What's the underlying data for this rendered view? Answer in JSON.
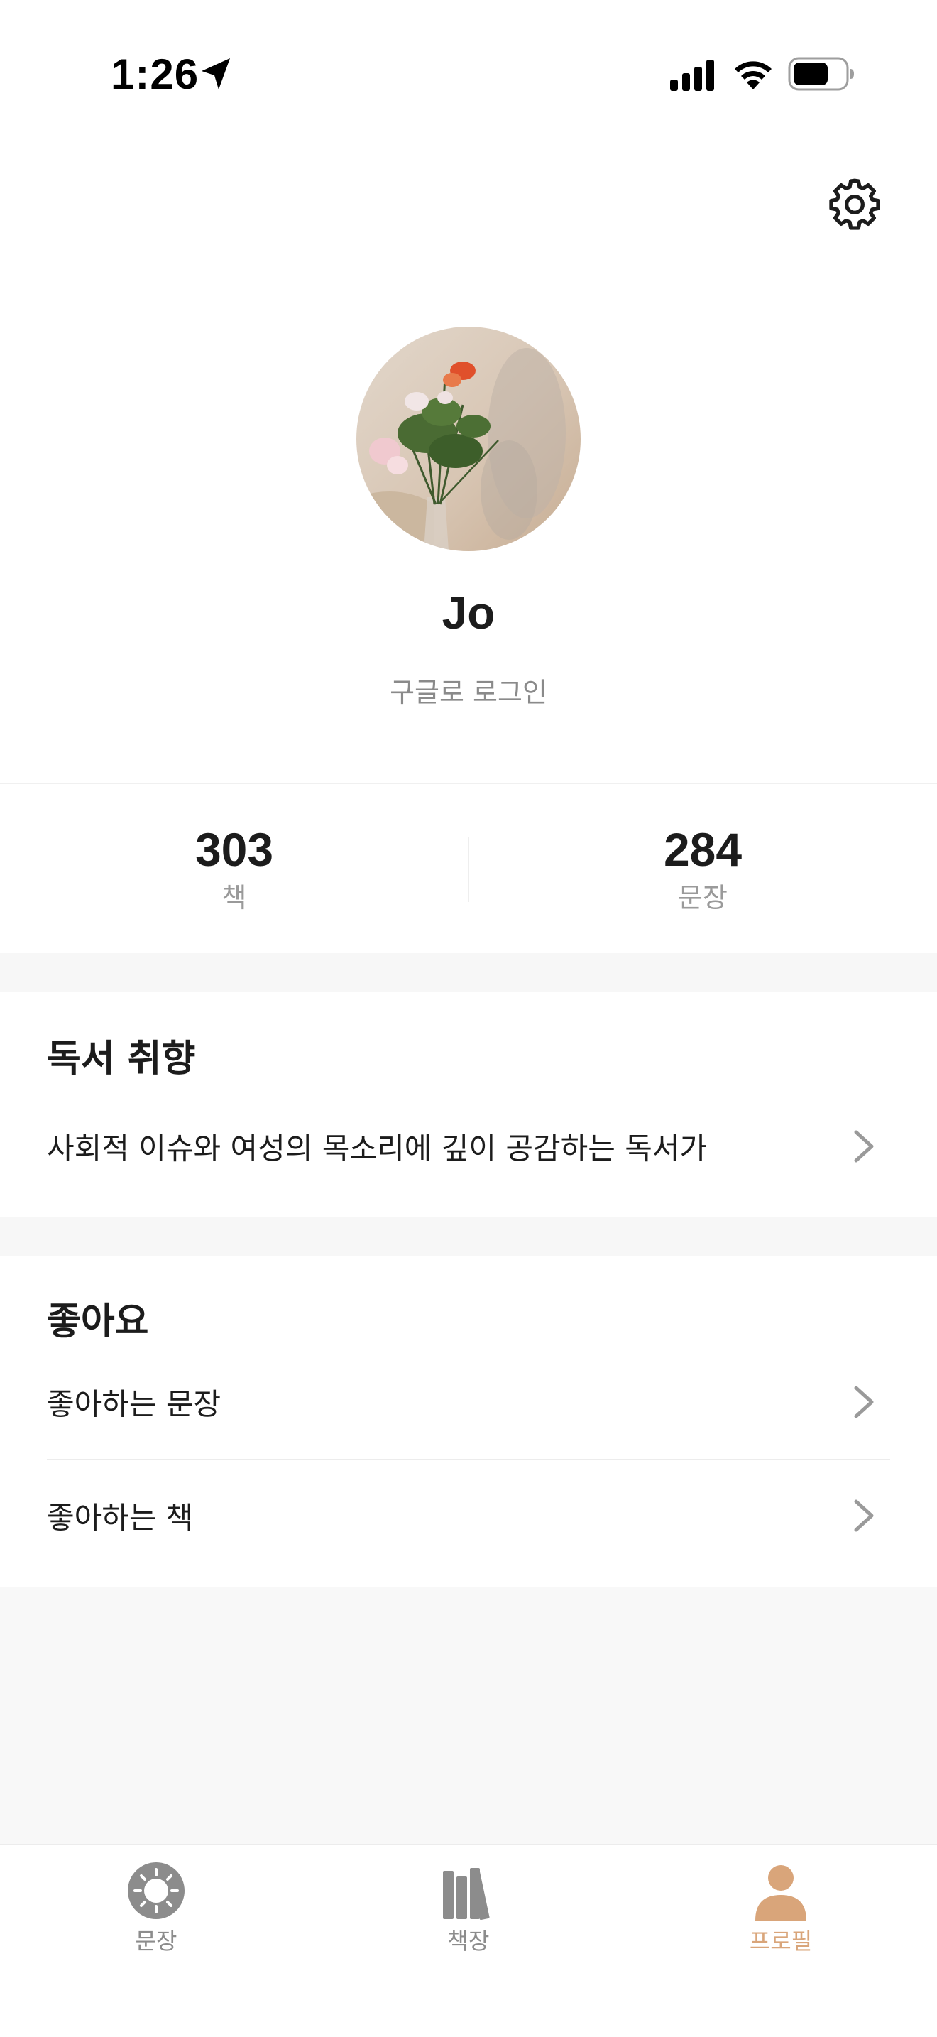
{
  "status_bar": {
    "time": "1:26"
  },
  "profile": {
    "name": "Jo",
    "login_method": "구글로 로그인"
  },
  "stats": [
    {
      "value": "303",
      "label": "책"
    },
    {
      "value": "284",
      "label": "문장"
    }
  ],
  "reading_taste": {
    "title": "독서 취향",
    "description": "사회적 이슈와 여성의 목소리에 깊이 공감하는 독서가"
  },
  "likes": {
    "title": "좋아요",
    "items": [
      {
        "label": "좋아하는 문장"
      },
      {
        "label": "좋아하는 책"
      }
    ]
  },
  "tab_bar": {
    "tabs": [
      {
        "label": "문장",
        "icon": "sentence-icon",
        "active": false
      },
      {
        "label": "책장",
        "icon": "bookshelf-icon",
        "active": false
      },
      {
        "label": "프로필",
        "icon": "profile-icon",
        "active": true
      }
    ]
  },
  "colors": {
    "accent": "#d9a57a",
    "text_primary": "#1c1c1c",
    "text_secondary": "#8a8a8a",
    "section_bg": "#f7f7f7"
  }
}
